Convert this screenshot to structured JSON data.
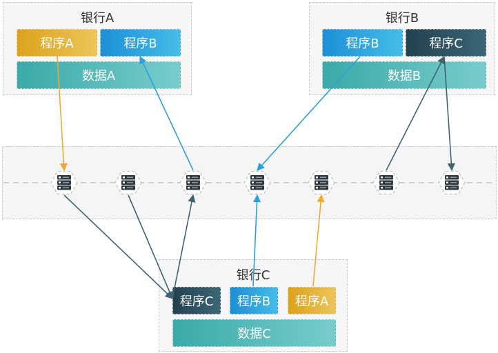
{
  "banks": [
    {
      "id": "A",
      "title": "银行A",
      "programs": [
        {
          "label": "程序A",
          "kind": "a"
        },
        {
          "label": "程序B",
          "kind": "b"
        }
      ],
      "data": "数据A"
    },
    {
      "id": "B",
      "title": "银行B",
      "programs": [
        {
          "label": "程序B",
          "kind": "b"
        },
        {
          "label": "程序C",
          "kind": "c"
        }
      ],
      "data": "数据B"
    },
    {
      "id": "C",
      "title": "银行C",
      "programs": [
        {
          "label": "程序C",
          "kind": "c"
        },
        {
          "label": "程序B",
          "kind": "b"
        },
        {
          "label": "程序A",
          "kind": "a"
        }
      ],
      "data": "数据C"
    }
  ],
  "network": {
    "node_count": 7,
    "node_icon": "server-node-icon"
  },
  "colors": {
    "program_a": "#dca21b",
    "program_b": "#2aa0df",
    "program_c": "#2d5262",
    "data": "#4db4b4",
    "link_a": "#f0a830",
    "link_b": "#2aa0df",
    "link_c": "#3e6472"
  },
  "connections": [
    {
      "from": "bankA.programA",
      "to": "node1",
      "color_key": "link_a"
    },
    {
      "from": "node3",
      "to": "bankA.programB",
      "color_key": "link_b"
    },
    {
      "from": "bankB.programB",
      "to": "node4",
      "color_key": "link_b"
    },
    {
      "from": "node6",
      "to": "bankB.programC",
      "color_key": "link_c"
    },
    {
      "from": "bankB.programC",
      "to": "node7",
      "color_key": "link_c"
    },
    {
      "from": "node1",
      "to": "bankC.programC",
      "color_key": "link_c"
    },
    {
      "from": "node2",
      "to": "bankC.programC",
      "color_key": "link_c"
    },
    {
      "from": "bankC.programC",
      "to": "node3",
      "color_key": "link_c"
    },
    {
      "from": "bankC.programB",
      "to": "node4",
      "color_key": "link_b"
    },
    {
      "from": "bankC.programA",
      "to": "node5",
      "color_key": "link_a"
    }
  ]
}
